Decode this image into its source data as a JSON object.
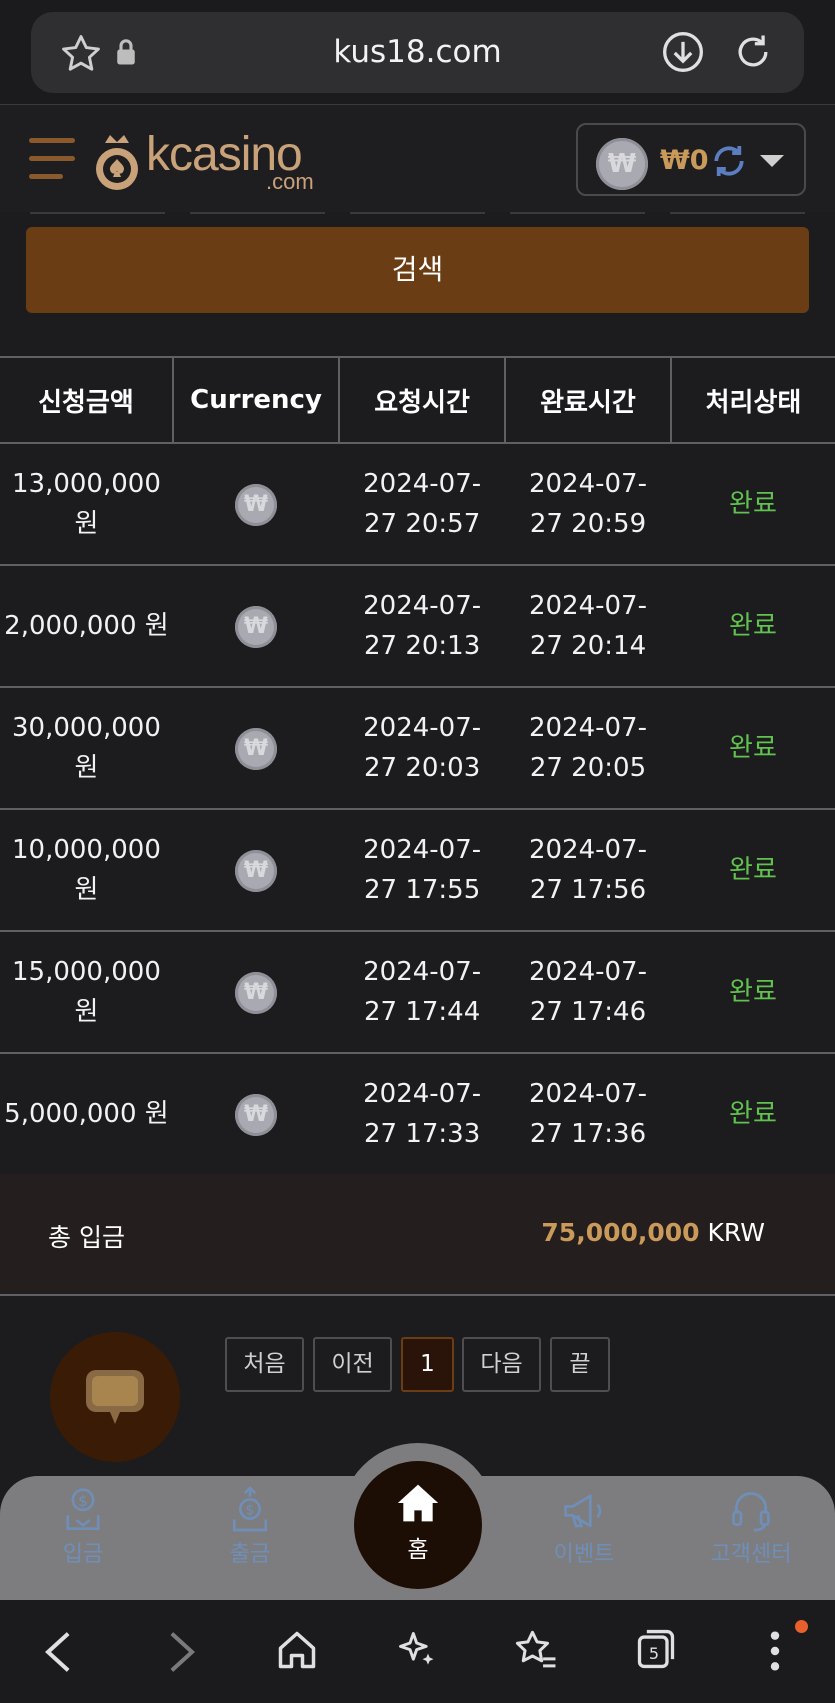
{
  "browser": {
    "url": "kus18.com",
    "tab_count": "5"
  },
  "header": {
    "logo": "kcasino",
    "logo_sub": ".com",
    "wallet_currency_symbol": "₩",
    "wallet_balance": "₩0"
  },
  "search": {
    "label": "검색"
  },
  "table": {
    "headers": [
      "신청금액",
      "Currency",
      "요청시간",
      "완료시간",
      "처리상태"
    ],
    "rows": [
      {
        "amount": "13,000,000 원",
        "request": "2024-07-27 20:57",
        "complete": "2024-07-27 20:59",
        "status": "완료"
      },
      {
        "amount": "2,000,000 원",
        "request": "2024-07-27 20:13",
        "complete": "2024-07-27 20:14",
        "status": "완료"
      },
      {
        "amount": "30,000,000 원",
        "request": "2024-07-27 20:03",
        "complete": "2024-07-27 20:05",
        "status": "완료"
      },
      {
        "amount": "10,000,000 원",
        "request": "2024-07-27 17:55",
        "complete": "2024-07-27 17:56",
        "status": "완료"
      },
      {
        "amount": "15,000,000 원",
        "request": "2024-07-27 17:44",
        "complete": "2024-07-27 17:46",
        "status": "완료"
      },
      {
        "amount": "5,000,000 원",
        "request": "2024-07-27 17:33",
        "complete": "2024-07-27 17:36",
        "status": "완료"
      }
    ]
  },
  "total": {
    "label": "총 입금",
    "amount": "75,000,000",
    "unit": "KRW"
  },
  "pagination": {
    "first": "처음",
    "prev": "이전",
    "current": "1",
    "next": "다음",
    "last": "끝"
  },
  "bottom_nav": {
    "deposit": "입금",
    "withdraw": "출금",
    "home": "홈",
    "event": "이벤트",
    "support": "고객센터"
  },
  "colors": {
    "accent": "#6b3d14",
    "gold": "#c99a5a",
    "status_ok": "#62c24f"
  }
}
